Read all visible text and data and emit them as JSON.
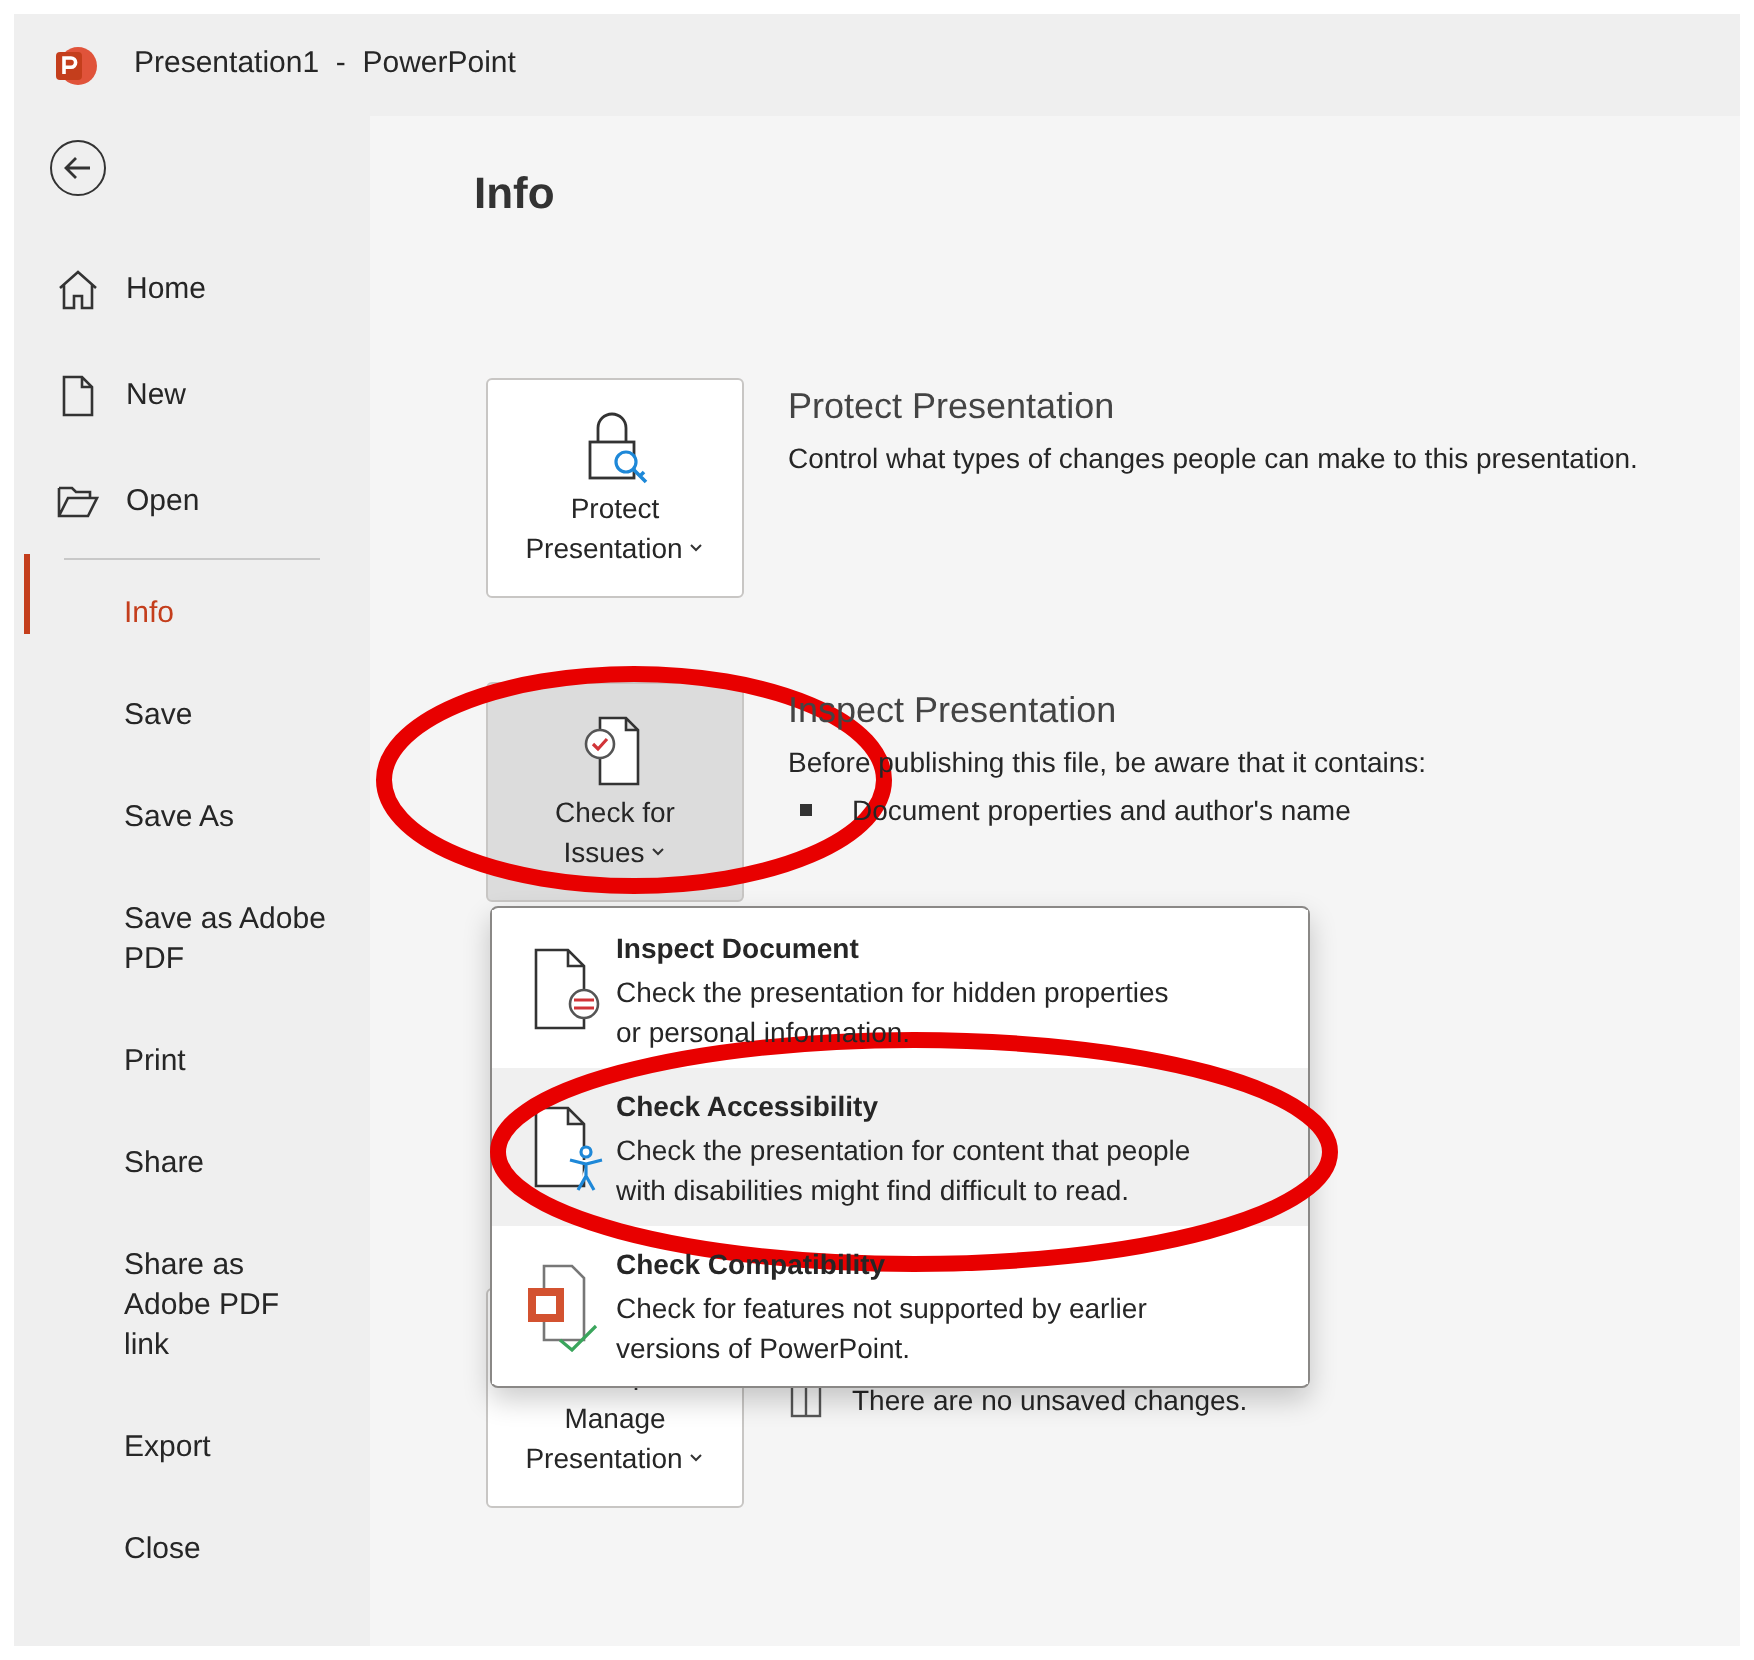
{
  "window": {
    "title": "Presentation1  -  PowerPoint"
  },
  "sidebar": {
    "items": [
      {
        "kind": "icon",
        "lines": [
          "Home"
        ],
        "selected": false
      },
      {
        "kind": "icon",
        "lines": [
          "New"
        ],
        "selected": false
      },
      {
        "kind": "icon",
        "lines": [
          "Open"
        ],
        "selected": false
      },
      {
        "kind": "divider"
      },
      {
        "kind": "text",
        "lines": [
          "Info"
        ],
        "selected": true
      },
      {
        "kind": "text",
        "lines": [
          "Save"
        ],
        "selected": false
      },
      {
        "kind": "text",
        "lines": [
          "Save As"
        ],
        "selected": false
      },
      {
        "kind": "text",
        "lines": [
          "Save as Adobe",
          "PDF"
        ],
        "selected": false
      },
      {
        "kind": "text",
        "lines": [
          "Print"
        ],
        "selected": false
      },
      {
        "kind": "text",
        "lines": [
          "Share"
        ],
        "selected": false
      },
      {
        "kind": "text",
        "lines": [
          "Share as",
          "Adobe PDF",
          "link"
        ],
        "selected": false
      },
      {
        "kind": "text",
        "lines": [
          "Export"
        ],
        "selected": false
      },
      {
        "kind": "text",
        "lines": [
          "Close"
        ],
        "selected": false
      }
    ]
  },
  "page_title": "Info",
  "sections": [
    {
      "button_lines": [
        "Protect",
        "Presentation"
      ],
      "pressed": false,
      "heading": "Protect Presentation",
      "description": "Control what types of changes people can make to this presentation."
    },
    {
      "button_lines": [
        "Check for",
        "Issues"
      ],
      "pressed": true,
      "heading": "Inspect Presentation",
      "description": "Before publishing this file, be aware that it contains:",
      "bullets": [
        "Document properties and author's name"
      ]
    },
    {
      "button_lines": [
        "Manage",
        "Presentation"
      ],
      "pressed": false,
      "status": "There are no unsaved changes."
    }
  ],
  "dropdown": {
    "items": [
      {
        "title": "Inspect Document",
        "description": [
          "Check the presentation for hidden properties",
          "or personal information."
        ],
        "selected": false
      },
      {
        "title": "Check Accessibility",
        "description": [
          "Check the presentation for content that people",
          "with disabilities might find difficult to read."
        ],
        "selected": true
      },
      {
        "title": "Check Compatibility",
        "description": [
          "Check for features not supported by earlier",
          "versions of PowerPoint."
        ],
        "selected": false
      }
    ]
  },
  "annotations": [
    {
      "kind": "ellipse",
      "color": "#e80000"
    },
    {
      "kind": "ellipse",
      "color": "#e80000"
    }
  ]
}
